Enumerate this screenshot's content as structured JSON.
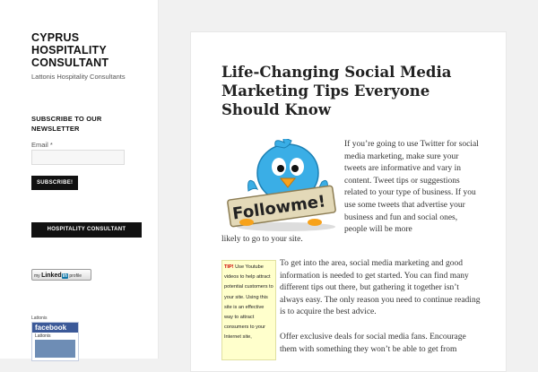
{
  "site": {
    "title": "CYPRUS HOSPITALITY CONSULTANT",
    "description": "Lattonis Hospitality Consultants"
  },
  "newsletter": {
    "heading": "SUBSCRIBE TO OUR NEWSLETTER",
    "email_label": "Email",
    "required_mark": "*",
    "email_value": "",
    "subscribe_label": "SUBSCRIBE!"
  },
  "widgets": {
    "hospitality_button": "HOSPITALITY CONSULTANT",
    "linkedin_badge": {
      "prefix": "my",
      "brand": "Linked",
      "brand_in": "in",
      "suffix": "profile"
    },
    "facebook": {
      "label": "Lattonis",
      "header": "facebook",
      "page_name": "Lattonis"
    }
  },
  "post": {
    "title": "Life-Changing Social Media Marketing Tips Everyone Should Know",
    "image_text": "Followme!",
    "paragraph1": "If you’re going to use Twitter for social media marketing, make sure your tweets are informative and vary in content. Tweet tips or suggestions related to your type of business. If you use some tweets that advertise your business and fun and social ones, people will be more likely to go to your site.",
    "paragraph1_part1": "If you’re going to use Twitter for social media marketing, make sure your tweets are informative and vary in content. Tweet tips or suggestions related to your type of business. If you use some tweets that advertise your business and fun and social ones, people will be more",
    "paragraph1_part2": "likely to go to your site.",
    "tip_label": "TIP!",
    "tip_text": "Use Youtube videos to help attract potential customers to your site. Using this site is an effective way to attract consumers to your Internet site,",
    "paragraph2": "To get into the area, social media marketing and good information is needed to get started. You can find many different tips out there, but gathering it together isn’t always easy. The only reason you need to continue reading is to acquire the best advice.",
    "paragraph3": "Offer exclusive deals for social media fans. Encourage them with something they won’t be able to get from"
  },
  "colors": {
    "background": "#f1f1f1",
    "button": "#111111",
    "facebook": "#3b5998",
    "tip_background": "#ffffcc",
    "tip_label": "#cc0000",
    "linkedin": "#0e76a8"
  }
}
